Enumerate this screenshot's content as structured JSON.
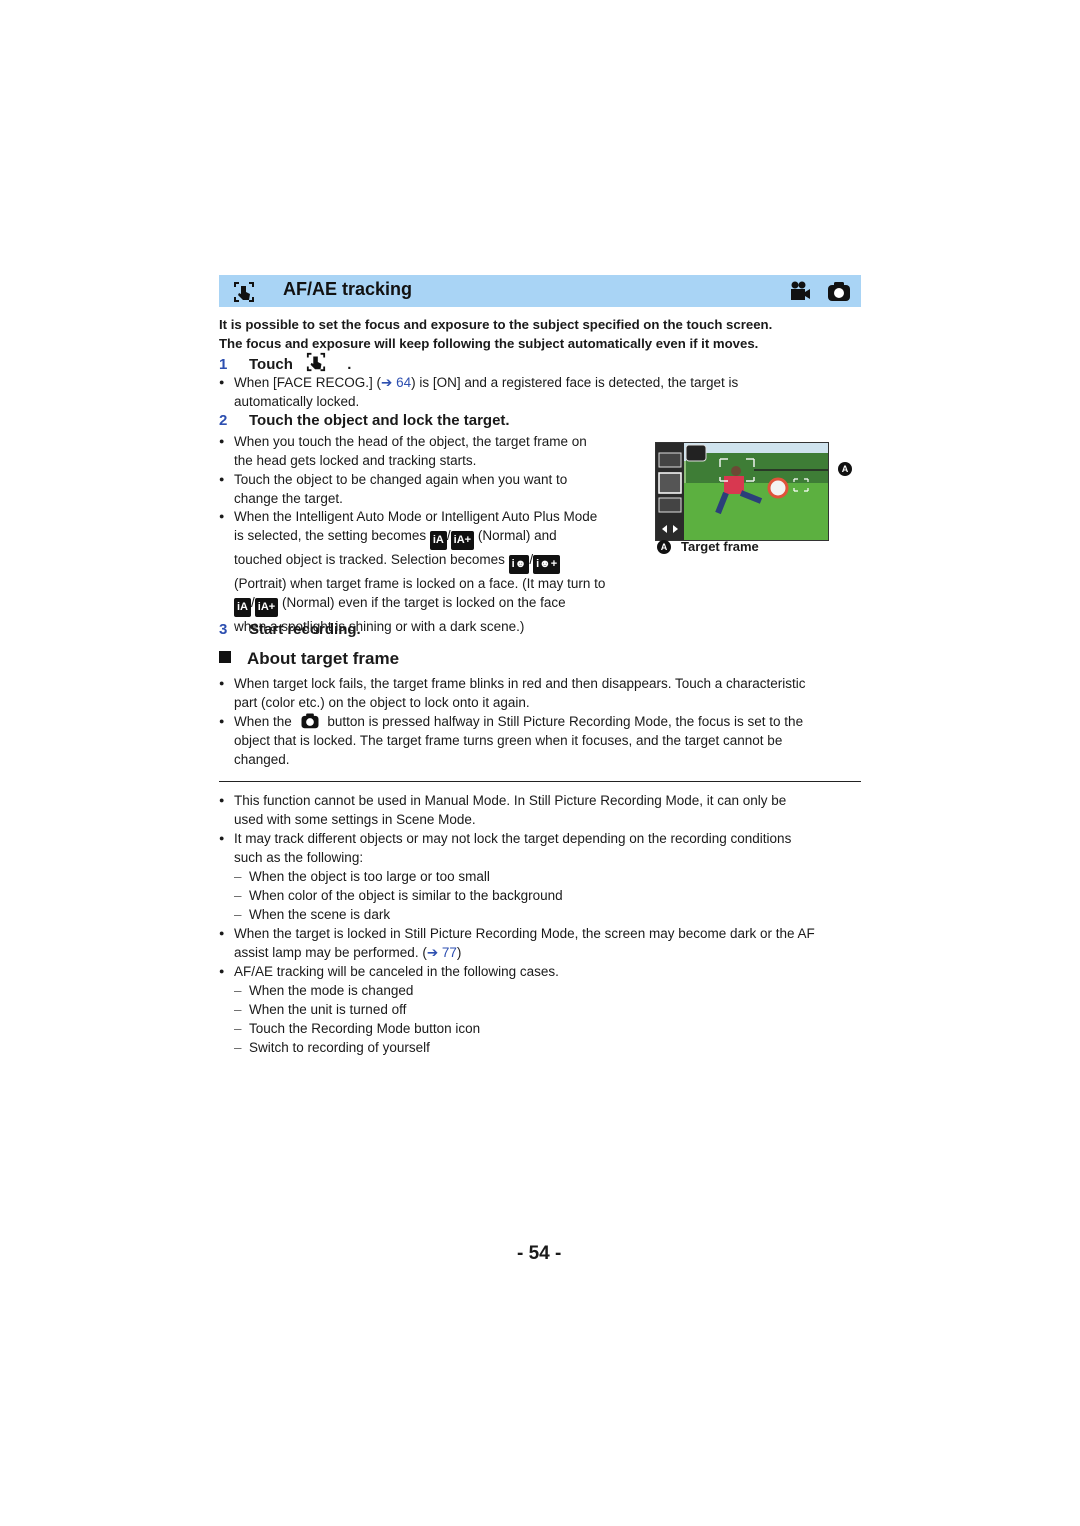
{
  "header": {
    "title": "AF/AE tracking",
    "left_icon": "touch-tracking-icon",
    "mode_icons": [
      "video-camera-icon",
      "still-camera-icon"
    ],
    "background_color": "#a9d4f5"
  },
  "intro": {
    "line1": "It is possible to set the focus and exposure to the subject specified on the touch screen.",
    "line2": "The focus and exposure will keep following the subject automatically even if it moves."
  },
  "steps": [
    {
      "num": "1",
      "label": "Touch",
      "suffix": "."
    },
    {
      "num": "2",
      "label": "Touch the object and lock the target."
    },
    {
      "num": "3",
      "label": "Start recording."
    }
  ],
  "step1_bullet": {
    "before": "When [FACE RECOG.] (",
    "arrow": "➔ 64",
    "after_line1": ") is [ON] and a registered face is detected, the target is",
    "line2": "automatically locked."
  },
  "step2_bullets": {
    "b1_l1": "When you touch the head of the object, the target frame on",
    "b1_l2": "the head gets locked and tracking starts.",
    "b2_l1": "Touch the object to be changed again when you want to",
    "b2_l2": "change the target.",
    "b3_l1": "When the Intelligent Auto Mode or Intelligent Auto Plus Mode",
    "b3_l2a": "is selected, the setting becomes",
    "b3_l2b": "(Normal) and",
    "b3_l3a": "touched object is tracked. Selection becomes",
    "b3_l4": "(Portrait) when target frame is locked on a face. (It may turn to",
    "b3_l5b": "(Normal) even if the target is locked on the face",
    "b3_l6": "when a spotlight is shining or with a dark scene.)",
    "slash": "/"
  },
  "figure": {
    "callout": "A",
    "caption_marker": "A",
    "caption": "Target frame"
  },
  "about": {
    "title": "About target frame",
    "b1_l1": "When target lock fails, the target frame blinks in red and then disappears. Touch a characteristic",
    "b1_l2": "part (color etc.) on the object to lock onto it again.",
    "b2_l1a": "When the",
    "b2_l1b": "button is pressed halfway in Still Picture Recording Mode, the focus is set to the",
    "b2_l2": "object that is locked. The target frame turns green when it focuses, and the target cannot be",
    "b2_l3": "changed."
  },
  "notes": {
    "n1_l1": "This function cannot be used in Manual Mode. In Still Picture Recording Mode, it can only be",
    "n1_l2": "used with some settings in Scene Mode.",
    "n2_l1": "It may track different objects or may not lock the target depending on the recording conditions",
    "n2_l2": "such as the following:",
    "n2_dashes": [
      "When the object is too large or too small",
      "When color of the object is similar to the background",
      "When the scene is dark"
    ],
    "n3_l1": "When the target is locked in Still Picture Recording Mode, the screen may become dark or the AF",
    "n3_l2a": "assist lamp may be performed. (",
    "n3_link": "➔ 77",
    "n3_l2b": ")",
    "n4_l1": "AF/AE tracking will be canceled in the following cases.",
    "n4_dashes": [
      "When the mode is changed",
      "When the unit is turned off",
      "Touch the Recording Mode button icon",
      "Switch to recording of yourself"
    ]
  },
  "page_number": "- 54 -"
}
